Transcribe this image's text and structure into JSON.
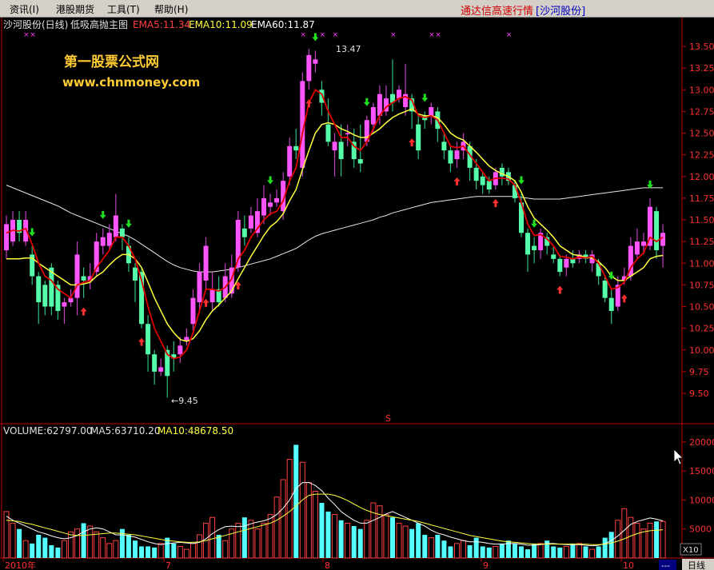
{
  "menu": {
    "items": [
      "资讯(I)",
      "港股期货",
      "工具(T)",
      "帮助(H)"
    ],
    "title_red": "通达信高速行情",
    "title_stock": "[沙河股份]"
  },
  "main_panel": {
    "stock_label": "沙河股份(日线)",
    "indicator_name": "低吸高抛主图",
    "ema5_label": "EMA5:11.34",
    "ema10_label": "EMA10:11.09",
    "ema60_label": "EMA60:11.87",
    "watermark_title": "第一股票公式网",
    "watermark_url": "www.chnmoney.com",
    "high_marker": "13.47",
    "low_marker": "←9.45",
    "s_marker": "S",
    "price_ticks": [
      "13.50",
      "13.25",
      "13.00",
      "12.75",
      "12.50",
      "12.25",
      "12.00",
      "11.75",
      "11.50",
      "11.25",
      "11.00",
      "10.75",
      "10.50",
      "10.25",
      "10.00",
      "9.75",
      "9.50"
    ]
  },
  "volume_panel": {
    "volume_label": "VOLUME:62797.00",
    "ma5_label": "MA5:63710.20",
    "ma10_label": "MA10:48678.50",
    "vol_ticks": [
      "20000",
      "15000",
      "10000",
      "5000"
    ],
    "unit": "X10"
  },
  "bottom_axis": {
    "labels": [
      "2010年",
      "7",
      "8",
      "9",
      "10"
    ],
    "period_button": "日线",
    "scroll_button": "---"
  },
  "colors": {
    "up": "#ff55ff",
    "down": "#55ffaa",
    "yellow_candle": "#e0c000",
    "ema5": "#e00000",
    "ema10": "#ffff40",
    "ema60": "#e8e8e8",
    "vol_up": "#ff4040",
    "vol_down": "#55ffff",
    "buy_arrow": "#ff3030",
    "sell_arrow": "#20e020",
    "axis": "#c00000"
  },
  "chart_data": {
    "type": "candlestick",
    "x_labels": [
      "2010年",
      "7",
      "8",
      "9",
      "10"
    ],
    "ylim": [
      9.35,
      13.7
    ],
    "candles": [
      [
        11.15,
        11.45,
        11.55,
        11.05
      ],
      [
        11.25,
        11.5,
        11.6,
        11.2
      ],
      [
        11.5,
        11.35,
        11.6,
        11.25
      ],
      [
        11.25,
        11.5,
        11.6,
        11.2
      ],
      [
        11.1,
        10.85,
        11.2,
        10.75
      ],
      [
        10.85,
        10.55,
        10.9,
        10.3
      ],
      [
        10.75,
        10.5,
        10.8,
        10.4
      ],
      [
        10.95,
        10.5,
        11.0,
        10.4
      ],
      [
        10.75,
        10.45,
        10.8,
        10.35
      ],
      [
        10.5,
        10.55,
        10.6,
        10.3
      ],
      [
        10.55,
        10.6,
        10.7,
        10.5
      ],
      [
        10.6,
        11.1,
        11.25,
        10.4
      ],
      [
        10.85,
        10.8,
        10.95,
        10.6
      ],
      [
        10.8,
        10.85,
        11.0,
        10.7
      ],
      [
        10.9,
        11.25,
        11.35,
        10.85
      ],
      [
        11.2,
        11.3,
        11.4,
        11.1
      ],
      [
        11.2,
        11.35,
        11.45,
        11.15
      ],
      [
        11.3,
        11.55,
        11.8,
        11.25
      ],
      [
        11.4,
        11.3,
        11.45,
        11.15
      ],
      [
        11.2,
        11.0,
        11.3,
        10.9
      ],
      [
        10.95,
        10.8,
        11.0,
        10.55
      ],
      [
        10.9,
        10.3,
        10.95,
        10.25
      ],
      [
        10.3,
        9.95,
        10.4,
        9.75
      ],
      [
        9.95,
        9.75,
        10.0,
        9.6
      ],
      [
        9.75,
        9.8,
        9.9,
        9.7
      ],
      [
        10.0,
        9.7,
        10.05,
        9.45
      ],
      [
        9.95,
        9.9,
        10.1,
        9.75
      ],
      [
        9.95,
        10.05,
        10.15,
        9.85
      ],
      [
        10.1,
        10.15,
        10.25,
        10.05
      ],
      [
        10.3,
        10.6,
        10.7,
        10.2
      ],
      [
        10.55,
        10.9,
        11.0,
        10.45
      ],
      [
        10.8,
        11.2,
        11.3,
        10.7
      ],
      [
        10.55,
        10.7,
        10.9,
        10.45
      ],
      [
        10.7,
        10.55,
        10.85,
        10.5
      ],
      [
        10.6,
        10.85,
        11.0,
        10.55
      ],
      [
        10.65,
        10.95,
        11.1,
        10.6
      ],
      [
        10.95,
        11.5,
        11.6,
        10.9
      ],
      [
        11.4,
        11.3,
        11.55,
        11.2
      ],
      [
        11.4,
        11.55,
        11.65,
        11.35
      ],
      [
        11.35,
        11.6,
        11.75,
        11.3
      ],
      [
        11.55,
        11.75,
        11.9,
        11.45
      ],
      [
        11.65,
        11.7,
        11.8,
        11.55
      ],
      [
        11.7,
        11.75,
        11.85,
        11.65
      ],
      [
        11.6,
        11.95,
        12.05,
        11.5
      ],
      [
        12.0,
        12.35,
        12.45,
        11.9
      ],
      [
        12.35,
        12.3,
        12.55,
        12.2
      ],
      [
        12.1,
        13.1,
        13.2,
        12.0
      ],
      [
        13.1,
        13.4,
        13.47,
        13.0
      ],
      [
        13.3,
        13.35,
        13.45,
        13.2
      ],
      [
        13.0,
        12.85,
        13.1,
        12.7
      ],
      [
        12.6,
        12.4,
        12.9,
        12.35
      ],
      [
        12.3,
        12.4,
        12.5,
        12.0
      ],
      [
        12.4,
        12.2,
        12.6,
        12.0
      ],
      [
        12.5,
        12.5,
        12.6,
        12.35
      ],
      [
        12.4,
        12.2,
        12.55,
        12.1
      ],
      [
        12.2,
        12.15,
        12.6,
        12.05
      ],
      [
        12.4,
        12.65,
        12.7,
        12.35
      ],
      [
        12.6,
        12.8,
        12.85,
        12.5
      ],
      [
        12.7,
        12.95,
        13.05,
        12.6
      ],
      [
        12.75,
        12.9,
        13.05,
        12.7
      ],
      [
        12.95,
        12.85,
        13.35,
        12.75
      ],
      [
        12.9,
        13.0,
        13.05,
        12.85
      ],
      [
        12.8,
        12.95,
        13.3,
        12.7
      ],
      [
        12.9,
        12.75,
        12.95,
        12.55
      ],
      [
        12.6,
        12.3,
        12.7,
        12.2
      ],
      [
        12.7,
        12.65,
        12.75,
        12.55
      ],
      [
        12.7,
        12.8,
        12.85,
        12.6
      ],
      [
        12.75,
        12.55,
        12.8,
        12.4
      ],
      [
        12.4,
        12.3,
        12.5,
        12.2
      ],
      [
        12.3,
        12.15,
        12.35,
        12.05
      ],
      [
        12.2,
        12.3,
        12.4,
        12.1
      ],
      [
        12.3,
        12.4,
        12.5,
        12.2
      ],
      [
        12.35,
        12.1,
        12.4,
        11.95
      ],
      [
        12.1,
        11.95,
        12.2,
        11.85
      ],
      [
        12.0,
        11.9,
        12.05,
        11.8
      ],
      [
        11.95,
        11.85,
        12.0,
        11.8
      ],
      [
        11.9,
        12.05,
        12.1,
        11.85
      ],
      [
        12.1,
        12.0,
        12.15,
        11.9
      ],
      [
        12.05,
        11.95,
        12.1,
        11.9
      ],
      [
        11.9,
        11.75,
        11.95,
        11.7
      ],
      [
        11.7,
        11.35,
        11.8,
        11.3
      ],
      [
        11.35,
        11.1,
        11.4,
        10.9
      ],
      [
        11.2,
        11.15,
        11.3,
        11.0
      ],
      [
        11.15,
        11.35,
        11.4,
        11.05
      ],
      [
        11.3,
        11.2,
        11.35,
        11.1
      ],
      [
        11.1,
        11.05,
        11.2,
        11.0
      ],
      [
        11.05,
        10.9,
        11.1,
        10.85
      ],
      [
        10.95,
        11.05,
        11.1,
        10.85
      ],
      [
        11.05,
        11.0,
        11.15,
        10.95
      ],
      [
        11.05,
        11.1,
        11.15,
        11.0
      ],
      [
        11.1,
        11.05,
        11.15,
        11.0
      ],
      [
        11.0,
        11.1,
        11.15,
        10.9
      ],
      [
        11.0,
        10.85,
        11.05,
        10.75
      ],
      [
        10.8,
        10.6,
        10.85,
        10.55
      ],
      [
        10.6,
        10.45,
        10.7,
        10.3
      ],
      [
        10.5,
        10.75,
        10.85,
        10.45
      ],
      [
        10.8,
        10.85,
        10.95,
        10.75
      ],
      [
        10.85,
        11.2,
        11.3,
        10.8
      ],
      [
        11.1,
        11.25,
        11.4,
        11.05
      ],
      [
        11.2,
        11.25,
        11.35,
        11.1
      ],
      [
        11.2,
        11.65,
        11.75,
        11.15
      ],
      [
        11.6,
        11.15,
        11.65,
        11.05
      ],
      [
        11.2,
        11.35,
        11.45,
        10.95
      ]
    ],
    "ema5": [
      11.35,
      11.38,
      11.37,
      11.4,
      11.22,
      11.0,
      10.85,
      10.8,
      10.7,
      10.65,
      10.6,
      10.75,
      10.78,
      10.8,
      10.95,
      11.05,
      11.15,
      11.3,
      11.3,
      11.2,
      11.05,
      10.8,
      10.5,
      10.25,
      10.1,
      9.95,
      9.9,
      9.92,
      10.0,
      10.2,
      10.45,
      10.7,
      10.7,
      10.68,
      10.72,
      10.82,
      11.05,
      11.15,
      11.3,
      11.4,
      11.5,
      11.57,
      11.6,
      11.72,
      11.95,
      12.1,
      12.5,
      12.85,
      13.0,
      12.95,
      12.75,
      12.6,
      12.45,
      12.45,
      12.35,
      12.3,
      12.4,
      12.55,
      12.7,
      12.8,
      12.85,
      12.9,
      12.92,
      12.88,
      12.7,
      12.68,
      12.7,
      12.65,
      12.5,
      12.35,
      12.33,
      12.35,
      12.25,
      12.15,
      12.05,
      11.95,
      11.98,
      11.98,
      11.97,
      11.9,
      11.7,
      11.45,
      11.32,
      11.33,
      11.28,
      11.2,
      11.08,
      11.07,
      11.05,
      11.07,
      11.06,
      11.08,
      11.0,
      10.85,
      10.7,
      10.72,
      10.78,
      10.95,
      11.05,
      11.12,
      11.3,
      11.25,
      11.3
    ],
    "ema10": [
      11.05,
      11.05,
      11.05,
      11.06,
      11.06,
      11.0,
      10.95,
      10.9,
      10.85,
      10.8,
      10.75,
      10.75,
      10.76,
      10.78,
      10.85,
      10.9,
      10.98,
      11.05,
      11.1,
      11.1,
      11.05,
      10.95,
      10.78,
      10.6,
      10.45,
      10.3,
      10.2,
      10.12,
      10.1,
      10.13,
      10.22,
      10.35,
      10.45,
      10.52,
      10.6,
      10.68,
      10.82,
      10.95,
      11.08,
      11.2,
      11.32,
      11.42,
      11.48,
      11.57,
      11.72,
      11.85,
      12.08,
      12.3,
      12.5,
      12.6,
      12.62,
      12.6,
      12.55,
      12.52,
      12.48,
      12.45,
      12.45,
      12.5,
      12.55,
      12.62,
      12.68,
      12.72,
      12.75,
      12.78,
      12.72,
      12.7,
      12.7,
      12.68,
      12.6,
      12.5,
      12.45,
      12.42,
      12.35,
      12.28,
      12.2,
      12.12,
      12.07,
      12.03,
      12.0,
      11.95,
      11.82,
      11.65,
      11.52,
      11.45,
      11.38,
      11.3,
      11.2,
      11.15,
      11.1,
      11.09,
      11.07,
      11.06,
      11.02,
      10.95,
      10.85,
      10.8,
      10.8,
      10.85,
      10.9,
      10.95,
      11.05,
      11.08,
      11.09
    ],
    "ema60": [
      11.9,
      11.87,
      11.84,
      11.81,
      11.78,
      11.75,
      11.72,
      11.69,
      11.66,
      11.62,
      11.58,
      11.55,
      11.52,
      11.49,
      11.46,
      11.43,
      11.4,
      11.37,
      11.34,
      11.31,
      11.27,
      11.22,
      11.17,
      11.12,
      11.07,
      11.02,
      10.98,
      10.95,
      10.93,
      10.91,
      10.9,
      10.9,
      10.9,
      10.91,
      10.92,
      10.93,
      10.95,
      10.97,
      10.99,
      11.01,
      11.03,
      11.05,
      11.08,
      11.11,
      11.14,
      11.17,
      11.22,
      11.27,
      11.31,
      11.34,
      11.36,
      11.38,
      11.4,
      11.42,
      11.44,
      11.46,
      11.48,
      11.5,
      11.53,
      11.55,
      11.58,
      11.6,
      11.62,
      11.64,
      11.66,
      11.68,
      11.7,
      11.71,
      11.72,
      11.73,
      11.74,
      11.75,
      11.76,
      11.77,
      11.77,
      11.77,
      11.77,
      11.77,
      11.77,
      11.77,
      11.76,
      11.75,
      11.74,
      11.74,
      11.74,
      11.74,
      11.74,
      11.75,
      11.76,
      11.77,
      11.78,
      11.79,
      11.8,
      11.81,
      11.82,
      11.83,
      11.84,
      11.85,
      11.86,
      11.87,
      11.87,
      11.87,
      11.87
    ],
    "buy_signals": [
      12,
      21,
      31,
      36,
      47,
      63,
      70,
      76,
      86,
      96
    ],
    "sell_signals": [
      4,
      15,
      19,
      41,
      48,
      56,
      65,
      80,
      82,
      94,
      100
    ],
    "volume_ylim": [
      0,
      21000
    ],
    "volume": [
      8000,
      6000,
      5000,
      3000,
      2500,
      4000,
      3500,
      2200,
      1800,
      3000,
      4500,
      5000,
      6000,
      5500,
      4500,
      3500,
      2500,
      3000,
      5000,
      4000,
      3000,
      2000,
      2000,
      1800,
      2500,
      3500,
      2500,
      2000,
      1500,
      2500,
      4000,
      6000,
      7000,
      4000,
      3000,
      5000,
      6000,
      7000,
      6500,
      5000,
      6000,
      7500,
      10500,
      13500,
      17000,
      19500,
      16500,
      13000,
      11500,
      9500,
      8000,
      7500,
      6500,
      6000,
      5500,
      5000,
      6500,
      9500,
      9000,
      7500,
      7000,
      6000,
      5500,
      5000,
      6000,
      4000,
      3500,
      4000,
      3000,
      2000,
      2500,
      3000,
      2200,
      3500,
      2000,
      1800,
      2000,
      2500,
      3000,
      2500,
      2000,
      1500,
      2500,
      2500,
      3000,
      2000,
      1800,
      2000,
      2500,
      2500,
      2000,
      1500,
      2000,
      3500,
      4500,
      6500,
      8500,
      7000,
      6000,
      5000,
      6000,
      6300,
      6300
    ],
    "volume_ma5": [
      7200,
      6500,
      6000,
      5500,
      5000,
      4500,
      4200,
      3800,
      3500,
      3300,
      3500,
      3900,
      4500,
      5000,
      5200,
      5000,
      4500,
      4000,
      4000,
      3800,
      3600,
      3200,
      2800,
      2500,
      2300,
      2500,
      2600,
      2700,
      2600,
      2500,
      2700,
      3300,
      4200,
      4900,
      5400,
      5500,
      5400,
      5500,
      5900,
      6200,
      6400,
      6800,
      7500,
      8600,
      10000,
      12000,
      13000,
      13000,
      12500,
      11600,
      10300,
      9200,
      8000,
      7200,
      6500,
      6000,
      6000,
      6500,
      7000,
      7600,
      8000,
      7500,
      7000,
      6500,
      6000,
      5500,
      4800,
      4300,
      4000,
      3600,
      3300,
      3000,
      2800,
      2800,
      2700,
      2500,
      2400,
      2400,
      2500,
      2500,
      2400,
      2200,
      2200,
      2300,
      2500,
      2500,
      2400,
      2300,
      2300,
      2300,
      2200,
      2100,
      2200,
      2500,
      3000,
      3800,
      4800,
      5800,
      6300,
      6600,
      6900,
      6700,
      6400
    ],
    "volume_ma10": [
      6500,
      6400,
      6300,
      6000,
      5800,
      5500,
      5200,
      4900,
      4600,
      4300,
      4000,
      3900,
      3900,
      4000,
      4100,
      4200,
      4300,
      4300,
      4200,
      4100,
      4000,
      3800,
      3600,
      3400,
      3200,
      3000,
      2900,
      2800,
      2700,
      2700,
      2800,
      3000,
      3300,
      3600,
      3900,
      4200,
      4500,
      4800,
      5100,
      5400,
      5700,
      6000,
      6500,
      7200,
      8000,
      9000,
      10000,
      10800,
      11000,
      11000,
      11000,
      10800,
      10400,
      9900,
      9300,
      8700,
      8200,
      7800,
      7500,
      7300,
      7100,
      6900,
      6700,
      6500,
      6300,
      6000,
      5700,
      5400,
      5100,
      4800,
      4500,
      4200,
      3900,
      3700,
      3500,
      3300,
      3100,
      2900,
      2800,
      2700,
      2600,
      2500,
      2400,
      2400,
      2400,
      2400,
      2400,
      2400,
      2400,
      2400,
      2400,
      2300,
      2300,
      2400,
      2600,
      2900,
      3300,
      3800,
      4200,
      4500,
      4700,
      4800,
      4870
    ]
  }
}
